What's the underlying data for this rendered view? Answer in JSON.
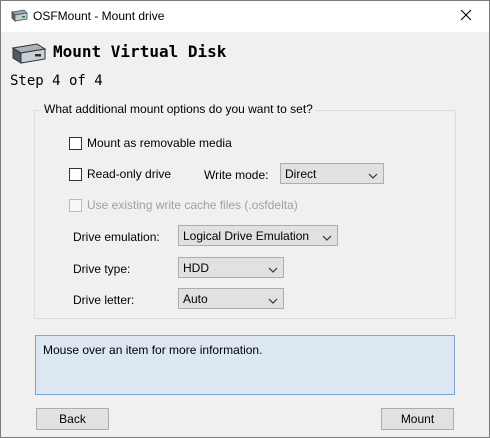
{
  "window": {
    "title": "OSFMount - Mount drive",
    "icons": {
      "app": "drive-icon",
      "close": "close-icon"
    }
  },
  "header": {
    "title": "Mount Virtual Disk",
    "step": "Step 4 of 4",
    "icon": "hard-drive-icon"
  },
  "options": {
    "group_label": "What additional mount options do you want to set?",
    "removable": {
      "label": "Mount as removable media",
      "checked": false
    },
    "readonly": {
      "label": "Read-only drive",
      "checked": false
    },
    "write_mode": {
      "label": "Write mode:",
      "value": "Direct"
    },
    "cache": {
      "label": "Use existing write cache files (.osfdelta)",
      "checked": false,
      "enabled": false
    },
    "emulation": {
      "label": "Drive emulation:",
      "value": "Logical Drive Emulation"
    },
    "drive_type": {
      "label": "Drive type:",
      "value": "HDD"
    },
    "drive_letter": {
      "label": "Drive letter:",
      "value": "Auto"
    }
  },
  "info": {
    "text": "Mouse over an item for more information."
  },
  "buttons": {
    "back": "Back",
    "mount": "Mount"
  },
  "colors": {
    "info_bg": "#dde7f1",
    "info_border": "#7aa7d6",
    "button_bg": "#e1e1e1"
  }
}
